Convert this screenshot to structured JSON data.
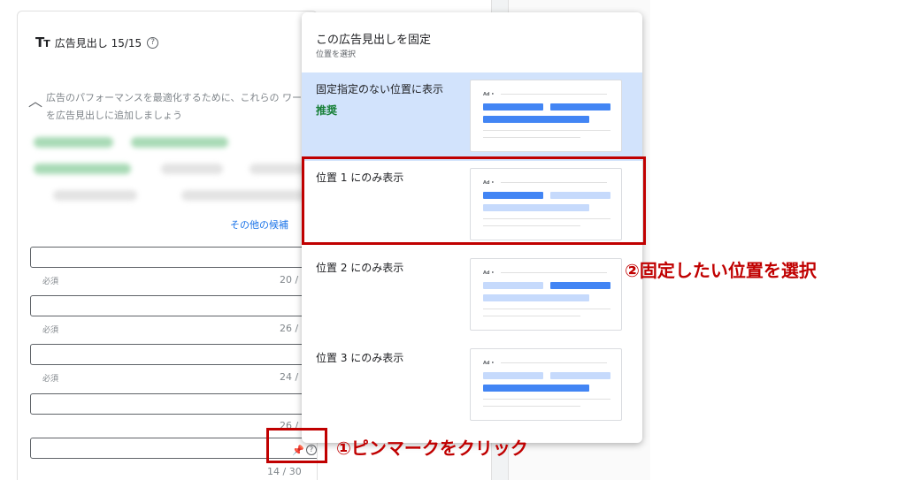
{
  "card": {
    "title": "広告見出し 15/15",
    "tt_icon": "TT",
    "suggestion_text": "広告のパフォーマンスを最適化するために、これらの ワードを広告見出しに追加しましょう",
    "more_link": "その他の候補",
    "fields": [
      {
        "required": "必須",
        "count": "20 /"
      },
      {
        "required": "必須",
        "count": "26 /"
      },
      {
        "required": "必須",
        "count": "24 /"
      },
      {
        "required": "",
        "count": "26 /"
      },
      {
        "required": "",
        "count": "14 / 30"
      }
    ]
  },
  "dropdown": {
    "title": "この広告見出しを固定",
    "subtitle": "位置を選択",
    "options": [
      {
        "label": "固定指定のない位置に表示",
        "badge": "推奨",
        "selected": true,
        "highlight": "none"
      },
      {
        "label": "位置 1 にのみ表示",
        "badge": "",
        "selected": false,
        "highlight": "first"
      },
      {
        "label": "位置 2 にのみ表示",
        "badge": "",
        "selected": false,
        "highlight": "second"
      },
      {
        "label": "位置 3 にのみ表示",
        "badge": "",
        "selected": false,
        "highlight": "third"
      }
    ],
    "preview_ad_label": "Ad •"
  },
  "annotations": {
    "step1": "①ピンマークをクリック",
    "step2": "②固定したい位置を選択"
  },
  "colors": {
    "annotation_red": "#c00000",
    "selected_bg": "#d2e3fc",
    "recommended_green": "#188038",
    "bar_dark": "#4285f4",
    "bar_light": "#c6dafc"
  }
}
